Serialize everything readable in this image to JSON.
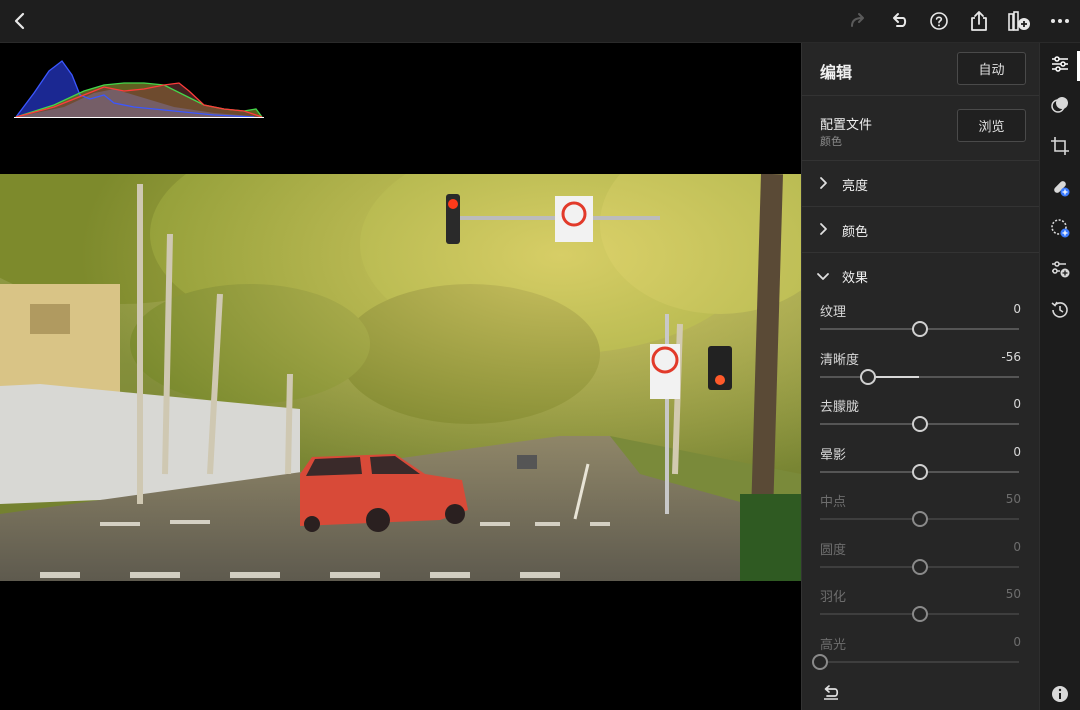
{
  "topbar": {
    "icons": [
      "back-icon",
      "redo-icon",
      "undo-icon",
      "help-icon",
      "share-icon",
      "add-to-album-icon",
      "more-icon"
    ]
  },
  "panel": {
    "title": "编辑",
    "auto_label": "自动",
    "profile": {
      "label": "配置文件",
      "value": "颜色",
      "browse_label": "浏览"
    },
    "sections": [
      {
        "label": "亮度",
        "expanded": false
      },
      {
        "label": "颜色",
        "expanded": false
      },
      {
        "label": "效果",
        "expanded": true
      }
    ],
    "sliders": [
      {
        "label": "纹理",
        "value": "0",
        "position": 0.5,
        "enabled": true
      },
      {
        "label": "清晰度",
        "value": "-56",
        "position": 0.24,
        "enabled": true
      },
      {
        "label": "去朦胧",
        "value": "0",
        "position": 0.5,
        "enabled": true
      },
      {
        "label": "晕影",
        "value": "0",
        "position": 0.5,
        "enabled": true
      },
      {
        "label": "中点",
        "value": "50",
        "position": 0.5,
        "enabled": false
      },
      {
        "label": "圆度",
        "value": "0",
        "position": 0.5,
        "enabled": false
      },
      {
        "label": "羽化",
        "value": "50",
        "position": 0.5,
        "enabled": false
      },
      {
        "label": "高光",
        "value": "0",
        "position": 0.0,
        "enabled": false
      }
    ]
  },
  "rail": {
    "icons": [
      "edit-sliders-icon",
      "presets-icon",
      "crop-icon",
      "healing-icon",
      "masking-icon",
      "versions-icon",
      "history-icon",
      "info-icon"
    ]
  },
  "colors": {
    "accent": "#ffffff",
    "panel_bg": "#262626",
    "background": "#000000"
  }
}
